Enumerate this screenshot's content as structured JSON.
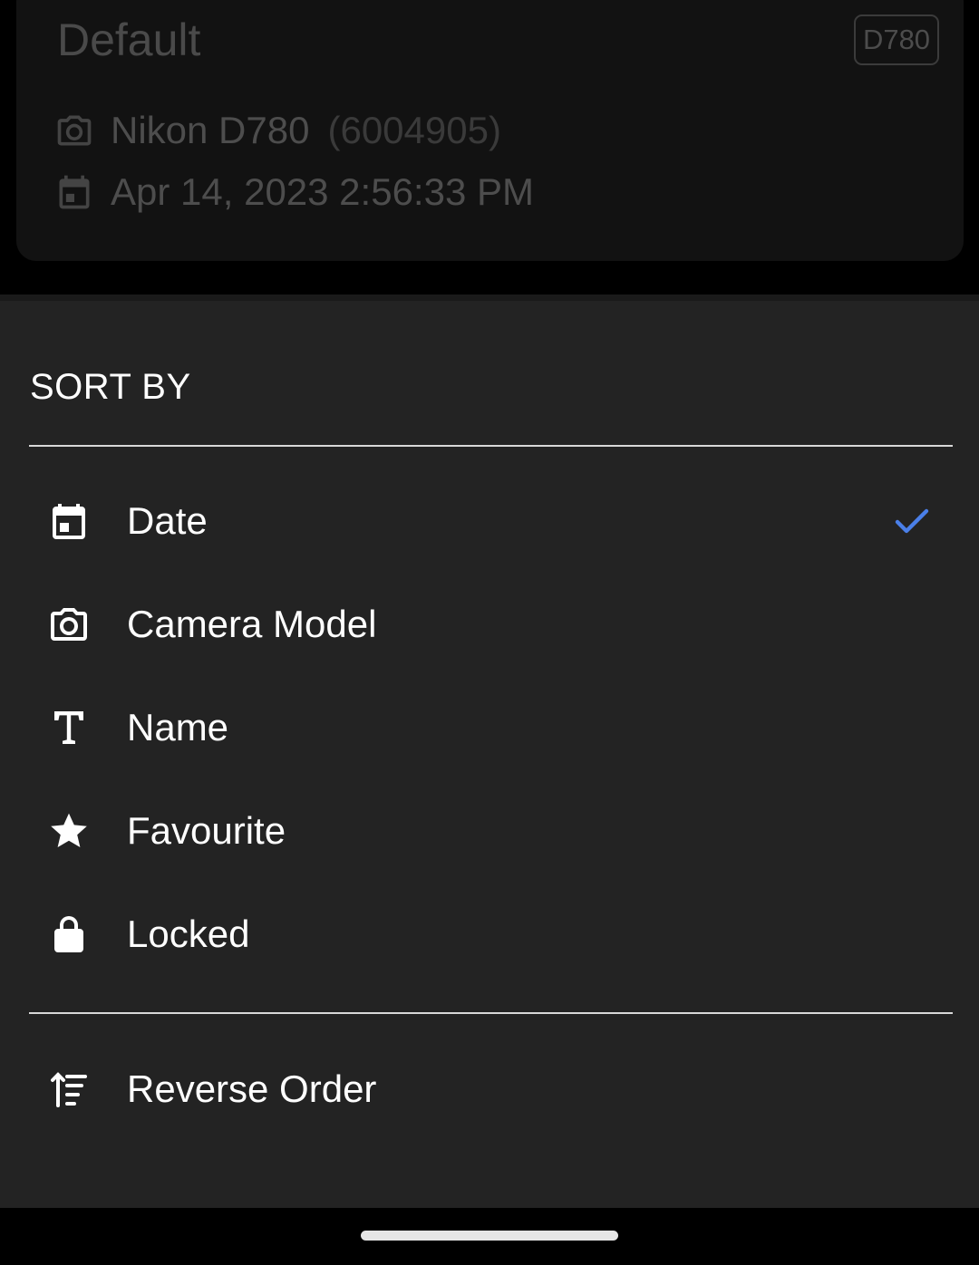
{
  "background_card": {
    "title": "Default",
    "badge": "D780",
    "camera_model": "Nikon D780",
    "camera_serial": "(6004905)",
    "date": "Apr 14, 2023 2:56:33 PM",
    "camera_icon": "camera-icon",
    "date_icon": "calendar-icon"
  },
  "sort_sheet": {
    "title": "SORT BY",
    "selected": "Date",
    "options": [
      {
        "label": "Date",
        "icon": "calendar-icon",
        "selected": true
      },
      {
        "label": "Camera Model",
        "icon": "camera-icon",
        "selected": false
      },
      {
        "label": "Name",
        "icon": "text-icon",
        "selected": false
      },
      {
        "label": "Favourite",
        "icon": "star-icon",
        "selected": false
      },
      {
        "label": "Locked",
        "icon": "lock-icon",
        "selected": false
      }
    ],
    "reverse_order": {
      "label": "Reverse Order",
      "icon": "sort-ascending-icon"
    }
  },
  "colors": {
    "sheet_background": "#232323",
    "check_accent": "#4a7fe8",
    "text": "#ffffff"
  }
}
